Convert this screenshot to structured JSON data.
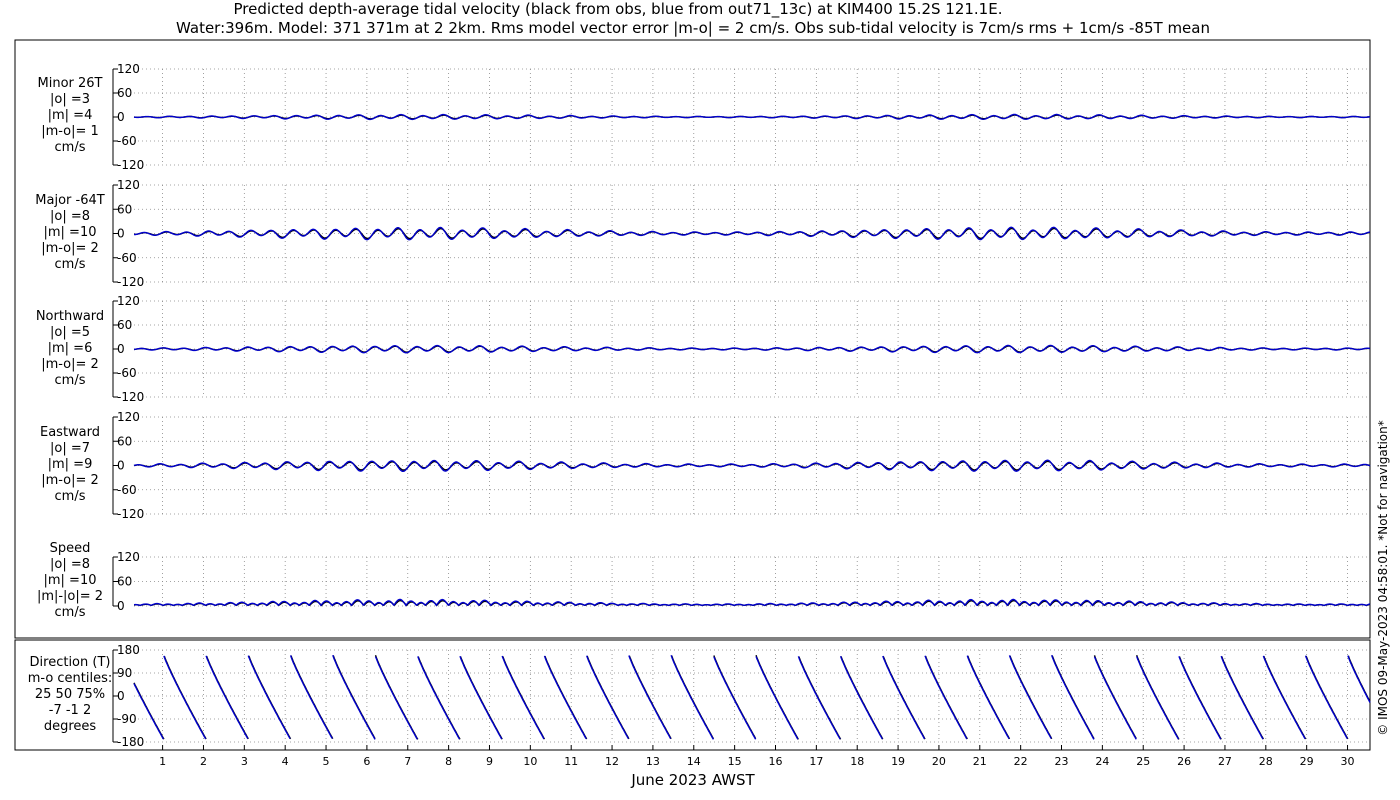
{
  "title_line1": "Predicted depth-average tidal velocity (black from obs, blue from out71_13c) at KIM400 15.2S 121.1E.",
  "title_line2": "Water:396m. Model: 371 371m at 2 2km. Rms model vector error |m-o| = 2 cm/s. Obs sub-tidal velocity is 7cm/s rms + 1cm/s -85T mean",
  "xlabel": "June 2023 AWST",
  "credit": "© IMOS 09-May-2023 04:58:01. *Not for navigation*",
  "colors": {
    "obs": "#000000",
    "model": "#0000cc",
    "grid": "#888888",
    "frame": "#000000"
  },
  "chart_data": [
    {
      "type": "line",
      "id": "minor",
      "label_lines": [
        "Minor 26T",
        "|o| =3",
        "|m| =4",
        "|m-o|= 1",
        "cm/s"
      ],
      "yticks": [
        "120",
        "60",
        "0",
        "-60",
        "-120"
      ],
      "ylim": [
        -120,
        120
      ],
      "series": [
        {
          "name": "obs",
          "amplitude": 3
        },
        {
          "name": "model",
          "amplitude": 4
        }
      ]
    },
    {
      "type": "line",
      "id": "major",
      "label_lines": [
        "Major -64T",
        "|o| =8",
        "|m| =10",
        "|m-o|= 2",
        "cm/s"
      ],
      "yticks": [
        "120",
        "60",
        "0",
        "-60",
        "-120"
      ],
      "ylim": [
        -120,
        120
      ],
      "series": [
        {
          "name": "obs",
          "amplitude": 8
        },
        {
          "name": "model",
          "amplitude": 10
        }
      ]
    },
    {
      "type": "line",
      "id": "northward",
      "label_lines": [
        "Northward",
        "|o| =5",
        "|m| =6",
        "|m-o|= 2",
        "cm/s"
      ],
      "yticks": [
        "120",
        "60",
        "0",
        "-60",
        "-120"
      ],
      "ylim": [
        -120,
        120
      ],
      "series": [
        {
          "name": "obs",
          "amplitude": 5
        },
        {
          "name": "model",
          "amplitude": 6
        }
      ]
    },
    {
      "type": "line",
      "id": "eastward",
      "label_lines": [
        "Eastward",
        "|o| =7",
        "|m| =9",
        "|m-o|= 2",
        "cm/s"
      ],
      "yticks": [
        "120",
        "60",
        "0",
        "-60",
        "-120"
      ],
      "ylim": [
        -120,
        120
      ],
      "series": [
        {
          "name": "obs",
          "amplitude": 7
        },
        {
          "name": "model",
          "amplitude": 9
        }
      ]
    },
    {
      "type": "line",
      "id": "speed",
      "label_lines": [
        "Speed",
        "|o| =8",
        "|m| =10",
        "|m|-|o|= 2",
        "cm/s"
      ],
      "yticks": [
        "120",
        "60",
        "0"
      ],
      "ylim": [
        0,
        120
      ],
      "series": [
        {
          "name": "obs",
          "amplitude": 8
        },
        {
          "name": "model",
          "amplitude": 10
        }
      ]
    },
    {
      "type": "line",
      "id": "direction",
      "label_lines": [
        "Direction (T)",
        "m-o centiles:",
        "25  50  75%",
        "-7 -1  2",
        "degrees"
      ],
      "yticks": [
        "180",
        "90",
        "0",
        "-90",
        "-180"
      ],
      "ylim": [
        -180,
        180
      ],
      "centiles": {
        "p25": -7,
        "p50": -1,
        "p75": 2
      },
      "series": [
        {
          "name": "obs"
        },
        {
          "name": "model"
        }
      ]
    }
  ],
  "x_axis": {
    "start_day": 0.3,
    "end_day": 30.55,
    "ticks": [
      "1",
      "2",
      "3",
      "4",
      "5",
      "6",
      "7",
      "8",
      "9",
      "10",
      "11",
      "12",
      "13",
      "14",
      "15",
      "16",
      "17",
      "18",
      "19",
      "20",
      "21",
      "22",
      "23",
      "24",
      "25",
      "26",
      "27",
      "28",
      "29",
      "30"
    ]
  }
}
